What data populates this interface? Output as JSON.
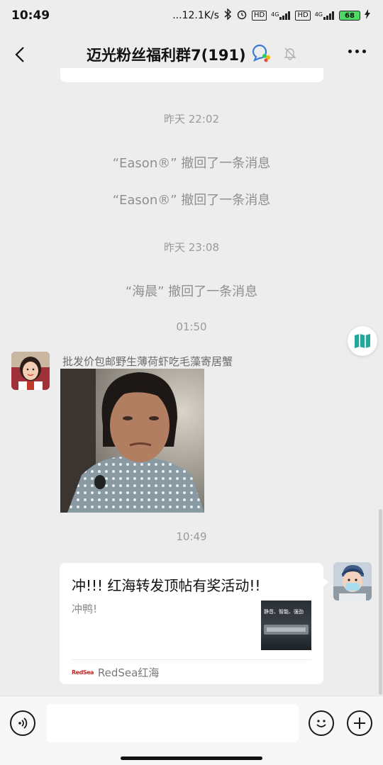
{
  "status_bar": {
    "time": "10:49",
    "net_speed": "...12.1K/s",
    "hd1": "HD",
    "net1": "4G",
    "hd2": "HD",
    "net2": "4G",
    "battery": "68"
  },
  "header": {
    "title": "迈光粉丝福利群7(191)"
  },
  "messages": {
    "time1": "昨天 22:02",
    "recall1": "“Eason®” 撤回了一条消息",
    "recall2": "“Eason®” 撤回了一条消息",
    "time2": "昨天 23:08",
    "recall3": "“海晨” 撤回了一条消息",
    "time3": "01:50",
    "sender_name": "批发价包邮野生薄荷虾吃毛藻寄居蟹",
    "time4": "10:49",
    "link_card": {
      "title": "冲!!! 红海转发顶帖有奖活动!!",
      "desc": "冲鸭!",
      "thumb_text": "静音、智能、强劲",
      "source_logo": "RedSea",
      "source": "RedSea红海"
    }
  },
  "input": {
    "value": "",
    "placeholder": ""
  }
}
